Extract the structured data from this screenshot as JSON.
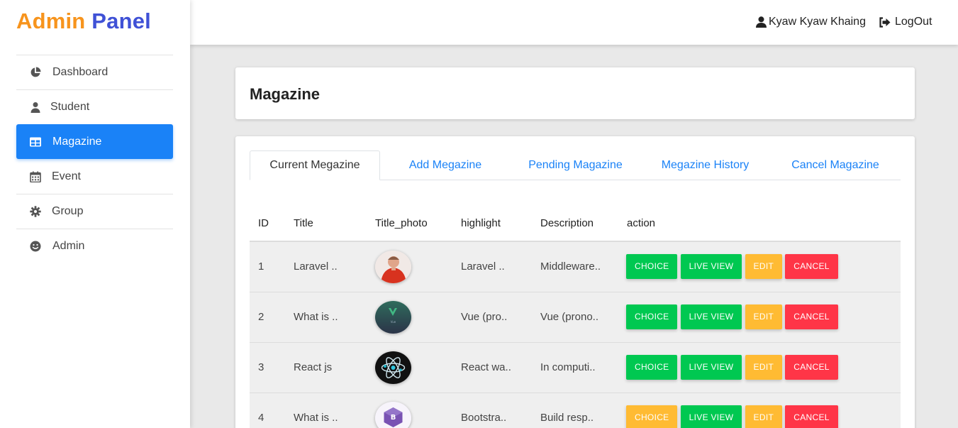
{
  "brand": {
    "part1": "Admin",
    "part2": "Panel"
  },
  "sidebar": {
    "items": [
      {
        "label": "Dashboard",
        "icon": "pie-chart-icon"
      },
      {
        "label": "Student",
        "icon": "user-icon"
      },
      {
        "label": "Magazine",
        "icon": "table-icon",
        "active": true
      },
      {
        "label": "Event",
        "icon": "calendar-icon"
      },
      {
        "label": "Group",
        "icon": "gear-icon"
      },
      {
        "label": "Admin",
        "icon": "smile-icon"
      }
    ]
  },
  "topbar": {
    "user_name": "Kyaw Kyaw Khaing",
    "logout_label": "LogOut"
  },
  "page": {
    "title": "Magazine"
  },
  "tabs": [
    {
      "label": "Current Megazine",
      "active": true
    },
    {
      "label": "Add Megazine"
    },
    {
      "label": "Pending Magazine"
    },
    {
      "label": "Megazine History"
    },
    {
      "label": "Cancel Magazine"
    }
  ],
  "table": {
    "headers": [
      "ID",
      "Title",
      "Title_photo",
      "highlight",
      "Description",
      "action"
    ],
    "rows": [
      {
        "id": "1",
        "title": "Laravel ..",
        "photo": "laravel-speaker-photo",
        "highlight": "Laravel ..",
        "description": "Middleware..",
        "choice": "CHOICE",
        "choice_color": "#00c851",
        "live": "LIVE VIEW",
        "edit": "EDIT",
        "cancel": "CANCEL"
      },
      {
        "id": "2",
        "title": "What is ..",
        "photo": "vue-logo-photo",
        "highlight": "Vue (pro..",
        "description": "Vue (prono..",
        "choice": "CHOICE",
        "choice_color": "#00c851",
        "live": "LIVE VIEW",
        "edit": "EDIT",
        "cancel": "CANCEL"
      },
      {
        "id": "3",
        "title": "React js",
        "photo": "react-logo-photo",
        "highlight": "React wa..",
        "description": "In computi..",
        "choice": "CHOICE",
        "choice_color": "#00c851",
        "live": "LIVE VIEW",
        "edit": "EDIT",
        "cancel": "CANCEL"
      },
      {
        "id": "4",
        "title": "What is ..",
        "photo": "bootstrap-logo-photo",
        "highlight": "Bootstra..",
        "description": "Build resp..",
        "choice": "CHOICE",
        "choice_color": "#ffbb33",
        "live": "LIVE VIEW",
        "edit": "EDIT",
        "cancel": "CANCEL"
      }
    ]
  },
  "colors": {
    "primary": "#1a82f7",
    "green": "#00c851",
    "orange": "#ffbb33",
    "red": "#ff3547",
    "brand_orange": "#f7941d",
    "brand_blue": "#3f51d6"
  }
}
